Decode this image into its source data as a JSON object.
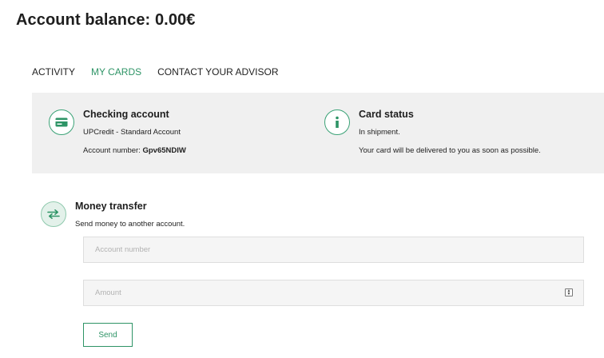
{
  "header": {
    "balance_label": "Account balance: 0.00€"
  },
  "tabs": [
    {
      "label": "ACTIVITY",
      "active": false
    },
    {
      "label": "MY CARDS",
      "active": true
    },
    {
      "label": "CONTACT YOUR ADVISOR",
      "active": false
    }
  ],
  "checking": {
    "title": "Checking account",
    "subtitle": "UPCredit - Standard Account",
    "account_number_label": "Account number:",
    "account_number_value": "Gpv65NDIW",
    "icon": "credit-card-icon"
  },
  "card_status": {
    "title": "Card status",
    "status": "In shipment.",
    "message": "Your card will be delivered to you as soon as possible.",
    "icon": "info-icon"
  },
  "transfer": {
    "title": "Money transfer",
    "description": "Send money to another account.",
    "icon": "transfer-arrows-icon",
    "account_placeholder": "Account number",
    "account_value": "",
    "amount_placeholder": "Amount",
    "amount_value": "",
    "send_label": "Send"
  },
  "colors": {
    "accent": "#2e9466",
    "panel_bg": "#f0f0f0"
  }
}
